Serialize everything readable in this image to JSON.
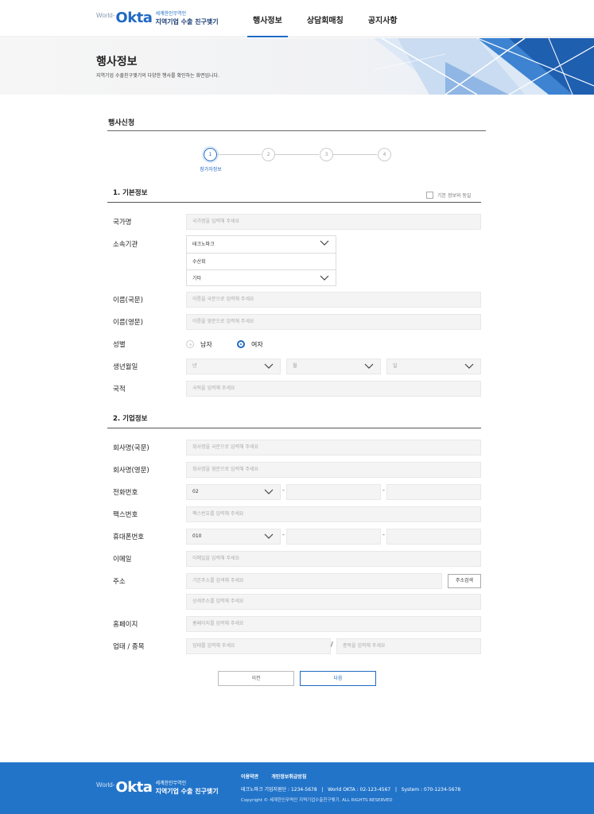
{
  "header": {
    "logo": {
      "world": "World-",
      "okta": "Okta",
      "sub1": "세계한인무역인",
      "sub2": "지역기업 수출 친구맺기"
    },
    "nav": [
      "행사정보",
      "상담회매칭",
      "공지사항"
    ]
  },
  "page": {
    "title": "행사정보",
    "desc": "지역기업 수출친구맺기의 다양한 행사를 확인하는 화면입니다."
  },
  "section_title": "행사신청",
  "steps": {
    "items": [
      "1",
      "2",
      "3",
      "4"
    ],
    "current": 1,
    "current_label": "참가자정보"
  },
  "basic": {
    "heading": "1. 기본정보",
    "same_label": "기본 정보와 동일",
    "country": {
      "label": "국가명",
      "placeholder": "국가명을 입력해 주세요"
    },
    "org": {
      "label": "소속기관",
      "selected": "테크노파크",
      "options": [
        "수산회",
        "기타"
      ]
    },
    "name_kr": {
      "label": "이름(국문)",
      "placeholder": "이름을 국문으로 입력해 주세요"
    },
    "name_en": {
      "label": "이름(영문)",
      "placeholder": "이름을 영문으로 입력해 주세요"
    },
    "gender": {
      "label": "성별",
      "male": "남자",
      "female": "여자",
      "selected": "여자"
    },
    "birth": {
      "label": "생년월일",
      "year": "년",
      "month": "월",
      "day": "일"
    },
    "nationality": {
      "label": "국적",
      "placeholder": "국적을 입력해 주세요"
    }
  },
  "company": {
    "heading": "2. 기업정보",
    "name_kr": {
      "label": "회사명(국문)",
      "placeholder": "회사명을 국문으로 입력해 주세요"
    },
    "name_en": {
      "label": "회사명(영문)",
      "placeholder": "회사명을 영문으로 입력해 주세요"
    },
    "phone": {
      "label": "전화번호",
      "area": "02",
      "sep": "-"
    },
    "fax": {
      "label": "팩스번호",
      "placeholder": "팩스번호를 입력해 주세요"
    },
    "mobile": {
      "label": "휴대폰번호",
      "prefix": "010",
      "sep": "-"
    },
    "email": {
      "label": "이메일",
      "placeholder": "이메일을 입력해 주세요"
    },
    "address": {
      "label": "주소",
      "placeholder1": "기본주소를 검색해 주세요",
      "search_btn": "주소검색",
      "placeholder2": "상세주소를 입력해 주세요"
    },
    "homepage": {
      "label": "홈페이지",
      "placeholder": "홈페이지를 입력해 주세요"
    },
    "business": {
      "label": "업태 / 종목",
      "placeholder1": "업태를 입력해 주세요",
      "slash": "/",
      "placeholder2": "종목을 입력해 주세요"
    }
  },
  "buttons": {
    "prev": "이전",
    "next": "다음"
  },
  "footer": {
    "links": [
      "이용약관",
      "개인정보취급방침"
    ],
    "info": "테크노파크 기업지원단 : 1234-5678   |   World OKTA : 02-123-4567   |   System : 070-1234-5678",
    "copyright": "Copyright © 세계한인무역인 지역기업수출친구맺기. ALL RIGHTS RESERVED"
  },
  "colors": {
    "accent": "#1f6ac4",
    "footer_bg": "#2274c9",
    "input_bg": "#f4f4f4"
  }
}
